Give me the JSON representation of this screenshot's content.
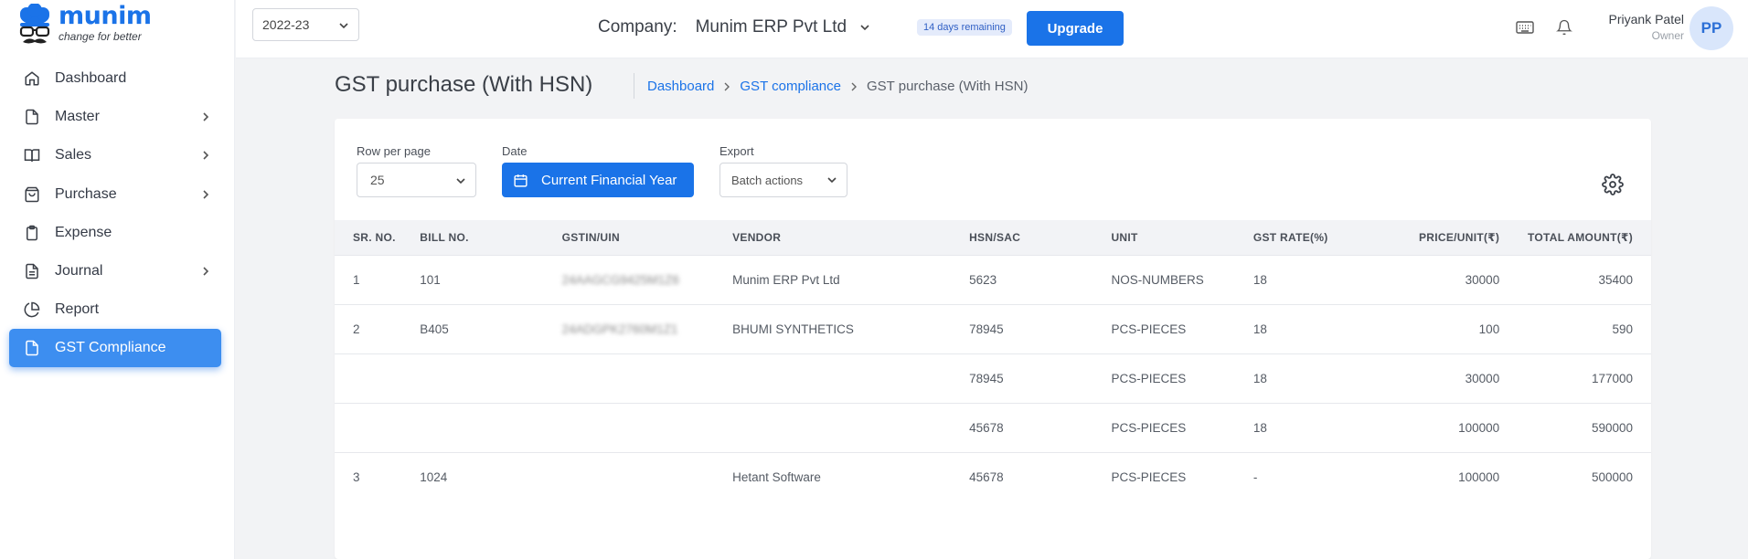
{
  "app": {
    "logo_name": "munim",
    "logo_tagline": "change for better"
  },
  "sidebar": {
    "items": [
      {
        "label": "Dashboard",
        "icon": "home-icon",
        "has_children": false
      },
      {
        "label": "Master",
        "icon": "file-icon",
        "has_children": true
      },
      {
        "label": "Sales",
        "icon": "book-icon",
        "has_children": true
      },
      {
        "label": "Purchase",
        "icon": "bag-icon",
        "has_children": true
      },
      {
        "label": "Expense",
        "icon": "clipboard-icon",
        "has_children": false
      },
      {
        "label": "Journal",
        "icon": "document-icon",
        "has_children": true
      },
      {
        "label": "Report",
        "icon": "pie-chart-icon",
        "has_children": false
      },
      {
        "label": "GST Compliance",
        "icon": "file-icon",
        "has_children": false,
        "active": true
      }
    ]
  },
  "topbar": {
    "financial_year": "2022-23",
    "company_label": "Company:",
    "company_name": "Munim ERP Pvt Ltd",
    "trial_badge": "14 days remaining",
    "upgrade_label": "Upgrade",
    "user_name": "Priyank Patel",
    "user_role": "Owner",
    "avatar_initials": "PP"
  },
  "page": {
    "title": "GST purchase (With HSN)",
    "breadcrumb": [
      "Dashboard",
      "GST compliance",
      "GST purchase (With HSN)"
    ]
  },
  "controls": {
    "rows_per_page_label": "Row per page",
    "rows_per_page_value": "25",
    "date_label": "Date",
    "date_value": "Current Financial Year",
    "export_label": "Export",
    "export_value": "Batch actions"
  },
  "table": {
    "columns": [
      "SR. NO.",
      "BILL NO.",
      "GSTIN/UIN",
      "VENDOR",
      "HSN/SAC",
      "UNIT",
      "GST RATE(%)",
      "PRICE/UNIT(₹)",
      "TOTAL AMOUNT(₹)"
    ],
    "rows": [
      {
        "sr": "1",
        "bill": "101",
        "gstin": "24AAGCG9425M1Z6",
        "vendor": "Munim ERP Pvt Ltd",
        "hsn": "5623",
        "unit": "NOS-NUMBERS",
        "rate": "18",
        "price": "30000",
        "total": "35400"
      },
      {
        "sr": "2",
        "bill": "B405",
        "gstin": "24ADGPK2760M1Z1",
        "vendor": "BHUMI SYNTHETICS",
        "hsn": "78945",
        "unit": "PCS-PIECES",
        "rate": "18",
        "price": "100",
        "total": "590"
      },
      {
        "sr": "",
        "bill": "",
        "gstin": "",
        "vendor": "",
        "hsn": "78945",
        "unit": "PCS-PIECES",
        "rate": "18",
        "price": "30000",
        "total": "177000"
      },
      {
        "sr": "",
        "bill": "",
        "gstin": "",
        "vendor": "",
        "hsn": "45678",
        "unit": "PCS-PIECES",
        "rate": "18",
        "price": "100000",
        "total": "590000"
      },
      {
        "sr": "3",
        "bill": "1024",
        "gstin": "",
        "vendor": "Hetant Software",
        "hsn": "45678",
        "unit": "PCS-PIECES",
        "rate": "-",
        "price": "100000",
        "total": "500000"
      }
    ]
  },
  "colors": {
    "accent": "#1a73e8",
    "active_nav": "#3d8ef0",
    "background": "#f2f3f5"
  }
}
